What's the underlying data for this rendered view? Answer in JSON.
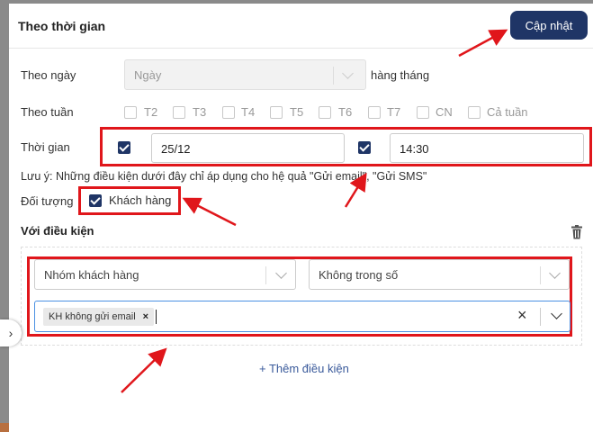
{
  "header": {
    "title": "Theo thời gian",
    "update_button": "Cập nhật"
  },
  "by_day": {
    "label": "Theo ngày",
    "placeholder": "Ngày",
    "suffix": "hàng tháng"
  },
  "by_week": {
    "label": "Theo tuần",
    "days": [
      "T2",
      "T3",
      "T4",
      "T5",
      "T6",
      "T7",
      "CN",
      "Cả tuần"
    ]
  },
  "time": {
    "label": "Thời gian",
    "date_value": "25/12",
    "time_value": "14:30"
  },
  "note": "Lưu ý: Những điều kiện dưới đây chỉ áp dụng cho hệ quả \"Gửi email\", \"Gửi SMS\"",
  "target": {
    "label": "Đối tượng",
    "option": "Khách hàng"
  },
  "conditions": {
    "title": "Với điều kiện",
    "field": "Nhóm khách hàng",
    "operator": "Không trong số",
    "tag": "KH không gửi email",
    "tag_remove": "×",
    "clear": "×",
    "add_label": "+ Thêm điều kiện"
  },
  "colors": {
    "primary": "#1f3566",
    "annotation": "#e0161b",
    "focus": "#4a90e2"
  },
  "icons": [
    "chevron-down-icon",
    "check-icon",
    "trash-icon",
    "close-icon",
    "chevron-right-icon"
  ]
}
